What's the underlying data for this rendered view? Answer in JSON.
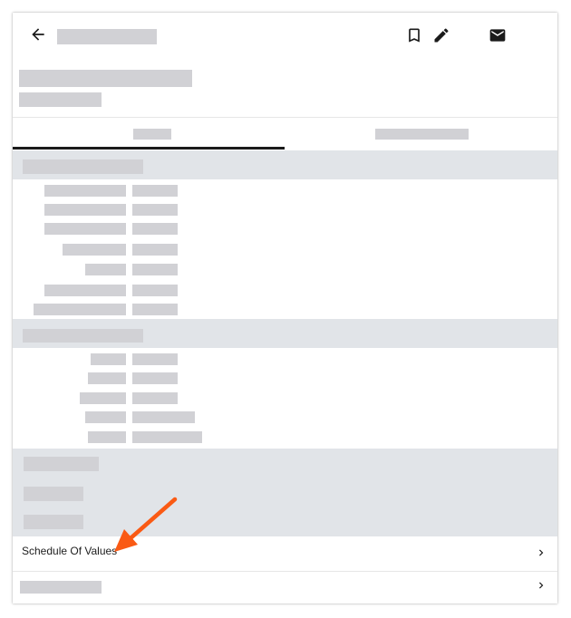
{
  "header": {
    "back_icon": "arrow-left-icon",
    "actions": [
      "bookmark-icon",
      "edit-icon",
      "mail-icon"
    ]
  },
  "list": {
    "items": [
      {
        "label": "Schedule Of Values",
        "icon": "chevron-right-icon"
      },
      {
        "label": "",
        "icon": "chevron-right-icon"
      }
    ]
  },
  "annotation": {
    "arrow_color": "#fa5a14"
  },
  "colors": {
    "placeholder": "#d1d1d5",
    "section_band": "#e1e4e8",
    "tab_indicator": "#1a1a1a"
  }
}
